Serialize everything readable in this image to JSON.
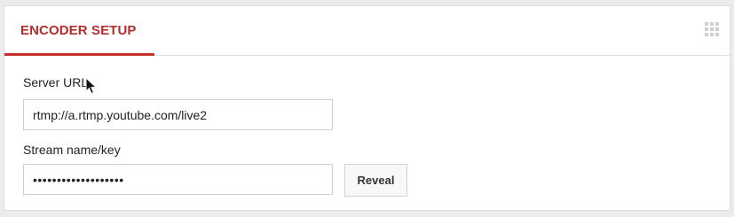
{
  "panel": {
    "tab_label": "ENCODER SETUP",
    "accent_color": "#c4302b"
  },
  "fields": {
    "server_url_label": "Server URL",
    "server_url_value": "rtmp://a.rtmp.youtube.com/live2",
    "stream_key_label": "Stream name/key",
    "stream_key_value": "•••••••••••••••••••"
  },
  "buttons": {
    "reveal_label": "Reveal"
  },
  "icons": {
    "drag_handle": "grid-dots-icon",
    "cursor": "mouse-pointer-icon"
  }
}
